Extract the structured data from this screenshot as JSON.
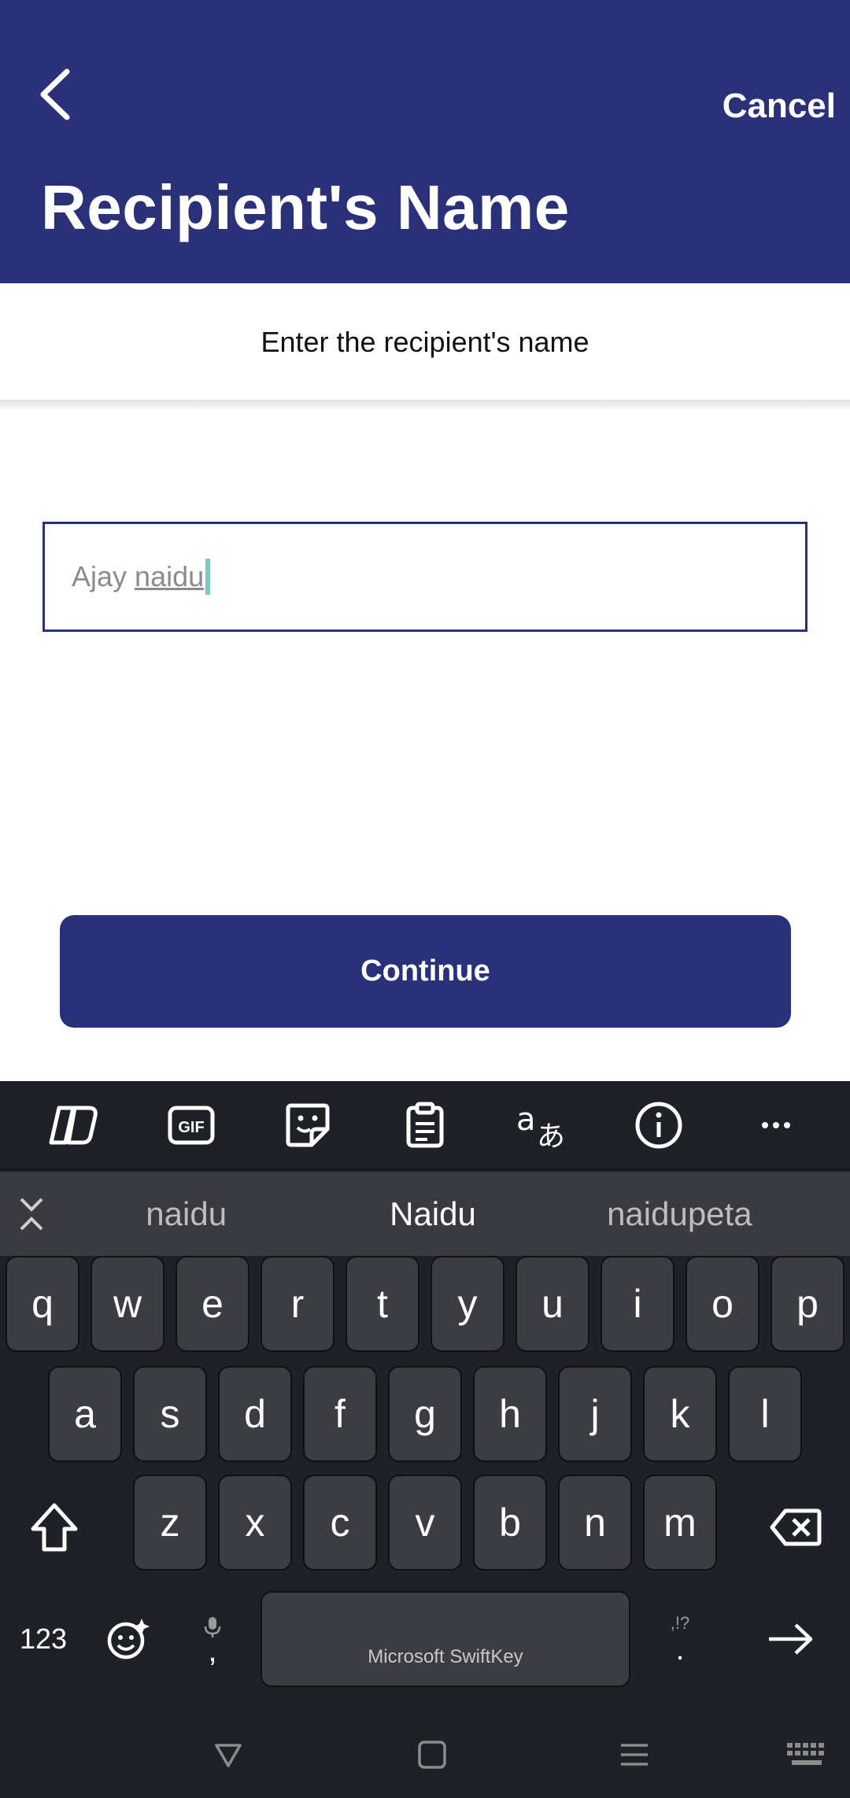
{
  "header": {
    "title": "Recipient's Name",
    "cancel_label": "Cancel",
    "background": "#2b3178"
  },
  "subtitle": "Enter the recipient's name",
  "input": {
    "value_plain": "Ajay ",
    "value_composing": "naidu"
  },
  "continue_label": "Continue",
  "keyboard": {
    "toolbar": [
      "copilot-icon",
      "gif-icon",
      "sticker-icon",
      "clipboard-icon",
      "translate-icon",
      "info-icon",
      "more-icon"
    ],
    "gif_label": "GIF",
    "suggestions": [
      "naidu",
      "Naidu",
      "naidupeta"
    ],
    "rows": [
      [
        "q",
        "w",
        "e",
        "r",
        "t",
        "y",
        "u",
        "i",
        "o",
        "p"
      ],
      [
        "a",
        "s",
        "d",
        "f",
        "g",
        "h",
        "j",
        "k",
        "l"
      ],
      [
        "z",
        "x",
        "c",
        "v",
        "b",
        "n",
        "m"
      ]
    ],
    "numbers_label": "123",
    "comma_label": ",",
    "period_label": ".",
    "punct_hint": ",!?",
    "space_label": "Microsoft SwiftKey"
  }
}
